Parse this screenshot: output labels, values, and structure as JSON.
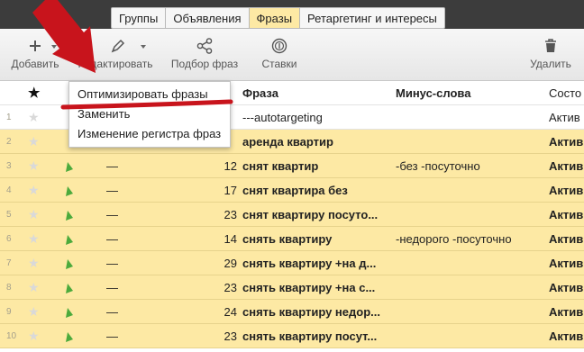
{
  "tabs": [
    {
      "label": "Группы",
      "active": false
    },
    {
      "label": "Объявления",
      "active": false
    },
    {
      "label": "Фразы",
      "active": true
    },
    {
      "label": "Ретаргетинг и интересы",
      "active": false
    }
  ],
  "toolbar": {
    "add": {
      "label": "Добавить",
      "icon": "plus-icon"
    },
    "edit": {
      "label": "Редактировать",
      "icon": "pencil-icon"
    },
    "phrase_select": {
      "label": "Подбор фраз",
      "icon": "share-nodes-icon"
    },
    "bids": {
      "label": "Ставки",
      "icon": "coin-icon"
    },
    "delete": {
      "label": "Удалить",
      "icon": "trash-icon"
    }
  },
  "edit_menu": {
    "items": [
      {
        "label": "Оптимизировать фразы"
      },
      {
        "label": "Заменить"
      },
      {
        "label": "Изменение регистра фраз"
      }
    ]
  },
  "table": {
    "headers": {
      "star": "★",
      "phrase": "Фраза",
      "minus": "Минус-слова",
      "status": "Состо"
    },
    "rows": [
      {
        "num": "1",
        "flag": false,
        "dash": "",
        "bid": "",
        "phrase": "---autotargeting",
        "minus": "",
        "status": "Актив",
        "selected": false
      },
      {
        "num": "2",
        "flag": false,
        "dash": "",
        "bid": "",
        "phrase": "аренда квартир",
        "minus": "",
        "status": "Актив",
        "selected": true
      },
      {
        "num": "3",
        "flag": true,
        "dash": "—",
        "bid": "12",
        "phrase": "снят квартир",
        "minus": "-без -посуточно",
        "status": "Актив",
        "selected": true
      },
      {
        "num": "4",
        "flag": true,
        "dash": "—",
        "bid": "17",
        "phrase": "снят квартира без",
        "minus": "",
        "status": "Актив",
        "selected": true
      },
      {
        "num": "5",
        "flag": true,
        "dash": "—",
        "bid": "23",
        "phrase": "снят квартиру посуто...",
        "minus": "",
        "status": "Актив",
        "selected": true
      },
      {
        "num": "6",
        "flag": true,
        "dash": "—",
        "bid": "14",
        "phrase": "снять квартиру",
        "minus": "-недорого -посуточно",
        "status": "Актив",
        "selected": true
      },
      {
        "num": "7",
        "flag": true,
        "dash": "—",
        "bid": "29",
        "phrase": "снять квартиру +на д...",
        "minus": "",
        "status": "Актив",
        "selected": true
      },
      {
        "num": "8",
        "flag": true,
        "dash": "—",
        "bid": "23",
        "phrase": "снять квартиру +на с...",
        "minus": "",
        "status": "Актив",
        "selected": true
      },
      {
        "num": "9",
        "flag": true,
        "dash": "—",
        "bid": "24",
        "phrase": "снять квартиру недор...",
        "minus": "",
        "status": "Актив",
        "selected": true
      },
      {
        "num": "10",
        "flag": true,
        "dash": "—",
        "bid": "23",
        "phrase": "снять квартиру посут...",
        "minus": "",
        "status": "Актив",
        "selected": true
      }
    ]
  },
  "colors": {
    "selected_row": "#fde9a4",
    "active_tab": "#fde9a4",
    "annotation": "#c8141c",
    "flag": "#4caa3c"
  }
}
